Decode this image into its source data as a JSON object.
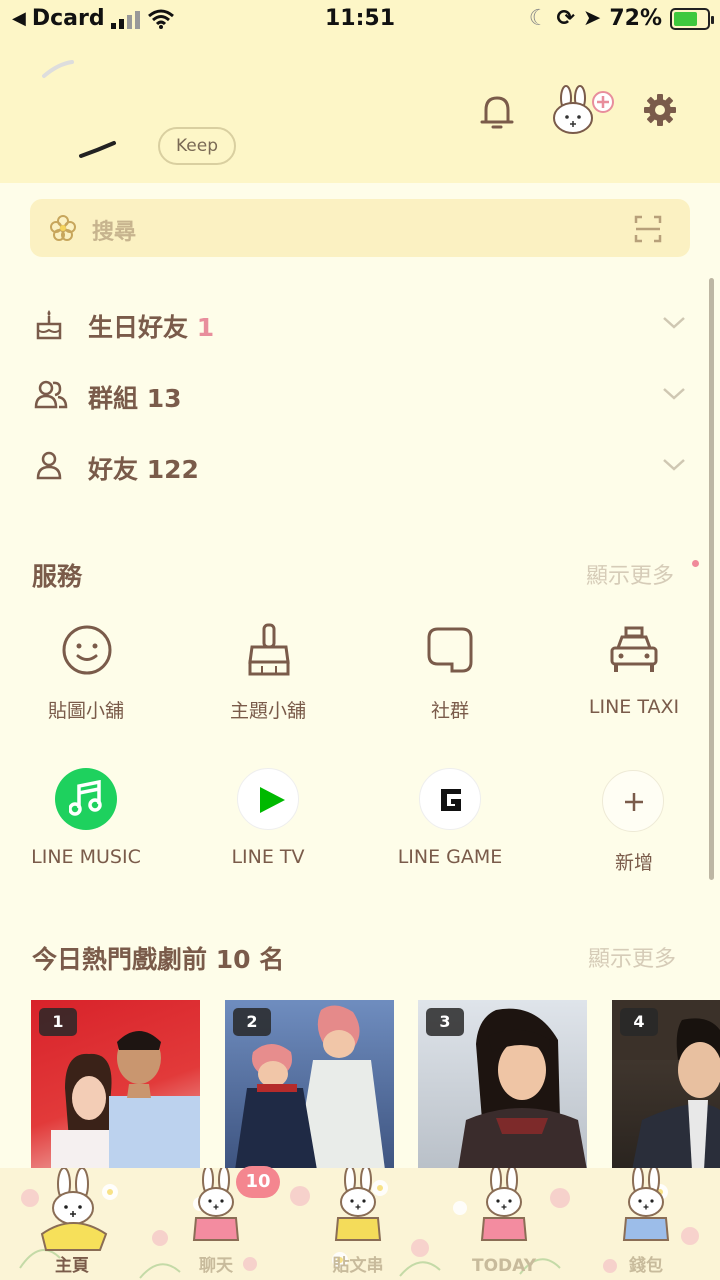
{
  "status_bar": {
    "carrier": "Dcard",
    "time": "11:51",
    "battery": "72%"
  },
  "header": {
    "keep_label": "Keep"
  },
  "search": {
    "placeholder": "搜尋"
  },
  "friend_groups": [
    {
      "label": "生日好友",
      "count": "1"
    },
    {
      "label": "群組",
      "count": "13"
    },
    {
      "label": "好友",
      "count": "122"
    }
  ],
  "services": {
    "title": "服務",
    "more": "顯示更多",
    "items": [
      {
        "label": "貼圖小舖",
        "icon": "smiley-icon"
      },
      {
        "label": "主題小舖",
        "icon": "brush-icon"
      },
      {
        "label": "社群",
        "icon": "square-chat-icon"
      },
      {
        "label": "LINE TAXI",
        "icon": "taxi-icon"
      },
      {
        "label": "LINE MUSIC",
        "icon": "music-icon",
        "color": "#1ed15e"
      },
      {
        "label": "LINE TV",
        "icon": "play-icon",
        "color": "#00b900"
      },
      {
        "label": "LINE GAME",
        "icon": "game-icon",
        "color": "#111111"
      },
      {
        "label": "新增",
        "icon": "plus-icon"
      }
    ]
  },
  "dramas": {
    "title": "今日熱門戲劇前 10 名",
    "more": "顯示更多",
    "items": [
      {
        "rank": "1"
      },
      {
        "rank": "2"
      },
      {
        "rank": "3"
      },
      {
        "rank": "4"
      }
    ]
  },
  "tabbar": {
    "tabs": [
      {
        "label": "主頁"
      },
      {
        "label": "聊天"
      },
      {
        "label": "貼文串"
      },
      {
        "label": "TODAY"
      },
      {
        "label": "錢包"
      }
    ],
    "chat_badge": "10"
  },
  "colors": {
    "header_bg": "#fdf6c7",
    "page_bg": "#fefde9",
    "text_brown": "#7a5b4a",
    "accent_pink": "#e88e9c"
  }
}
